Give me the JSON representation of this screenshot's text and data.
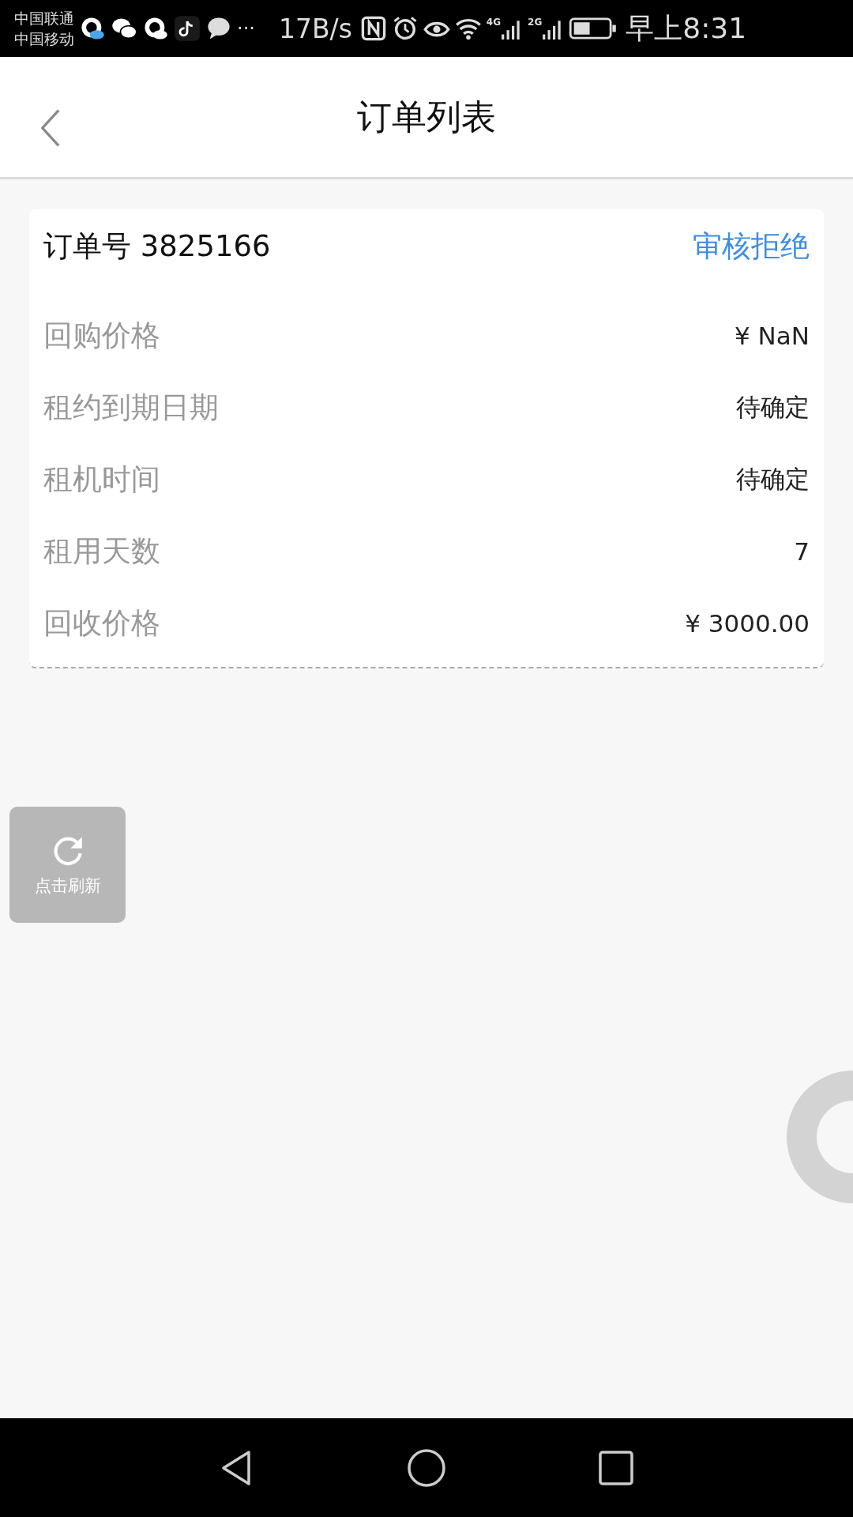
{
  "status_bar": {
    "carriers": [
      "中国联通",
      "中国移动"
    ],
    "more": "···",
    "net_speed": "17B/s",
    "network_labels": [
      "4G",
      "2G"
    ],
    "time": "早上8:31"
  },
  "header": {
    "title": "订单列表"
  },
  "order": {
    "label": "订单号",
    "number": "3825166",
    "status": "审核拒绝"
  },
  "rows": [
    {
      "label": "回购价格",
      "value": "¥ NaN"
    },
    {
      "label": "租约到期日期",
      "value": "待确定"
    },
    {
      "label": "租机时间",
      "value": "待确定"
    },
    {
      "label": "租用天数",
      "value": "7"
    },
    {
      "label": "回收价格",
      "value": "¥ 3000.00"
    }
  ],
  "refresh_button": {
    "label": "点击刷新"
  }
}
